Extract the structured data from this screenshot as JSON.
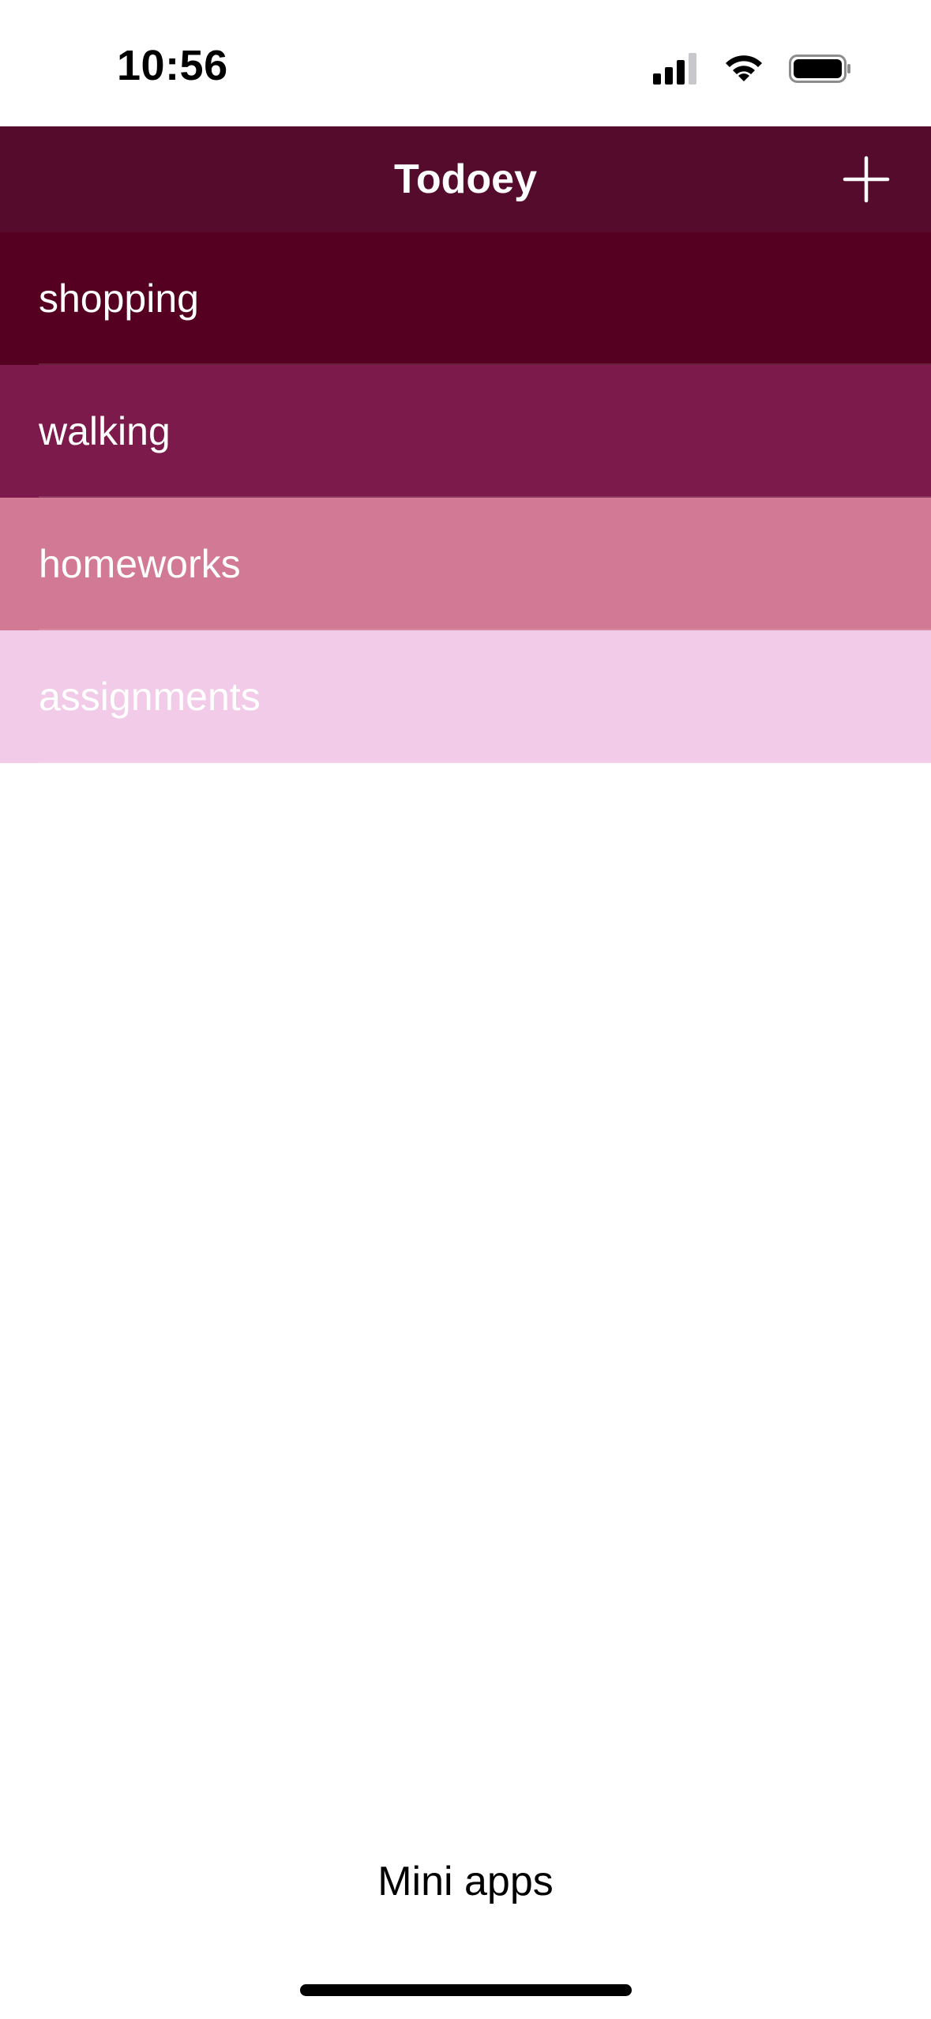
{
  "status_bar": {
    "time": "10:56"
  },
  "nav": {
    "title": "Todoey",
    "add_icon": "plus-icon",
    "background": "#550b2c"
  },
  "list": {
    "items": [
      {
        "label": "shopping",
        "background": "#550020",
        "text_color": "#ffffff"
      },
      {
        "label": "walking",
        "background": "#7c1b4b",
        "text_color": "#ffffff"
      },
      {
        "label": "homeworks",
        "background": "#d27995",
        "text_color": "#ffffff"
      },
      {
        "label": "assignments",
        "background": "#f2cbe8",
        "text_color": "#ffffff"
      }
    ]
  },
  "footer": {
    "label": "Mini apps"
  }
}
